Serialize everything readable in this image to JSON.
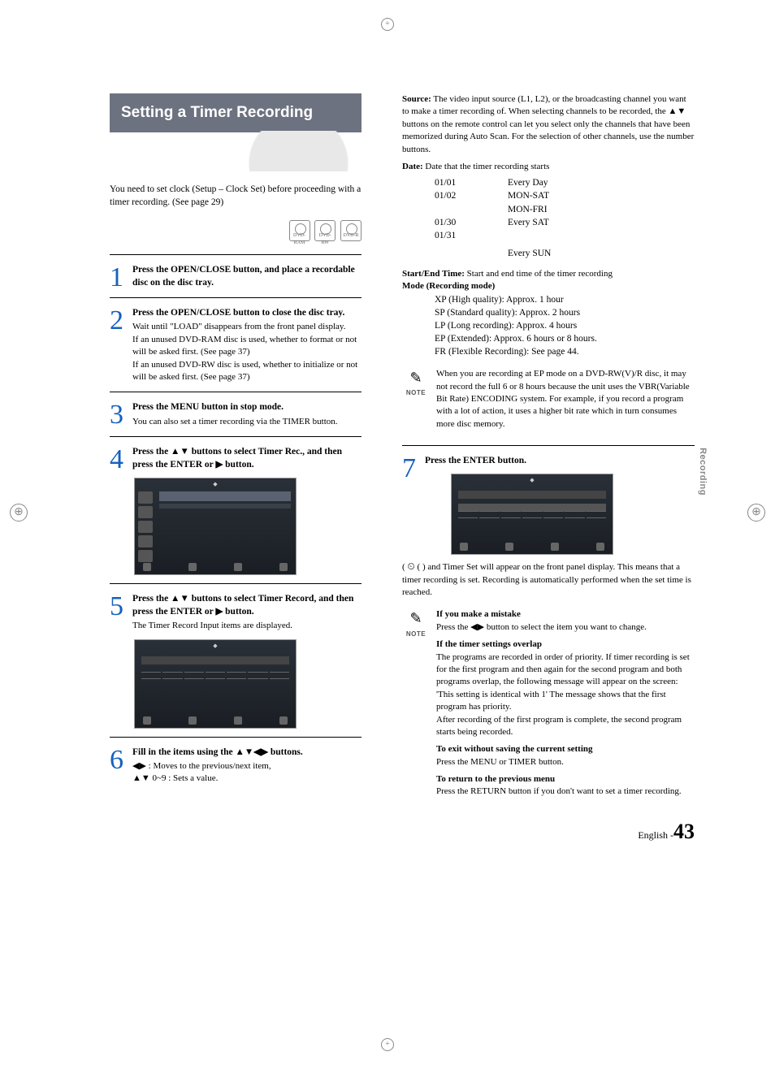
{
  "title": "Setting a Timer Recording",
  "intro": "You need to set clock (Setup – Clock Set) before proceeding with a timer recording. (See page 29)",
  "disc_icons": [
    "DVD-RAM",
    "DVD-RW",
    "DVD-R"
  ],
  "steps": {
    "s1": {
      "num": "1",
      "head": "Press the OPEN/CLOSE button, and place a recordable disc on the disc tray."
    },
    "s2": {
      "num": "2",
      "head": "Press the OPEN/CLOSE button to close the disc tray.",
      "body": "Wait until \"LOAD\" disappears from the front panel display.\nIf an unused DVD-RAM disc is used, whether to format or not will be asked first. (See page 37)\nIf an unused DVD-RW disc is used, whether to initialize or not will be asked first. (See page 37)"
    },
    "s3": {
      "num": "3",
      "head": "Press the MENU button in stop mode.",
      "body": "You can also set a timer recording via the TIMER button."
    },
    "s4": {
      "num": "4",
      "head": "Press the ▲▼ buttons to select Timer Rec., and then press the ENTER or ▶ button."
    },
    "s5": {
      "num": "5",
      "head": "Press the ▲▼ buttons to select Timer Record, and then press the ENTER or ▶ button.",
      "body": "The Timer Record Input items are displayed."
    },
    "s6": {
      "num": "6",
      "head": "Fill in the items using the ▲▼◀▶ buttons.",
      "body_a": "◀▶ : Moves to the previous/next item,",
      "body_b": "▲▼ 0~9 : Sets a value."
    },
    "s7": {
      "num": "7",
      "head": "Press the ENTER button."
    }
  },
  "right": {
    "source": {
      "label": "Source:",
      "text": "The video input source (L1, L2), or  the broadcasting channel you want to make a  timer recording of. When selecting channels to be recorded, the ▲▼ buttons on the remote control can let you select only the channels that have been memorized during Auto Scan. For the selection of other channels, use the number buttons."
    },
    "date": {
      "label": "Date:",
      "text": "Date that the timer recording starts",
      "rows": [
        {
          "a": "01/01",
          "b": "Every Day"
        },
        {
          "a": "01/02",
          "b": "MON-SAT"
        },
        {
          "a": "",
          "b": "MON-FRI"
        },
        {
          "a": "01/30",
          "b": "Every SAT"
        },
        {
          "a": "01/31",
          "b": ""
        },
        {
          "a": "",
          "b": "Every SUN"
        }
      ]
    },
    "time": {
      "label": "Start/End Time:",
      "text": "Start and end time of the timer recording"
    },
    "mode": {
      "label": "Mode (Recording mode)",
      "items": [
        "XP (High quality): Approx. 1 hour",
        "SP (Standard quality): Approx. 2 hours",
        "LP (Long recording): Approx. 4 hours",
        "EP (Extended): Approx. 6 hours or 8 hours.",
        "FR (Flexible Recording): See page 44."
      ]
    },
    "note1": "When you are recording at EP mode on a DVD-RW(V)/R disc, it may not record the full 6 or 8 hours because the unit uses the VBR(Variable Bit Rate) ENCODING system. For example, if you record a program with a lot of action, it uses a higher bit rate which in turn consumes more disc memory.",
    "after7": "(  ) and Timer Set will appear on the front panel display. This means that a timer recording is set. Recording is automatically performed when the set time is reached.",
    "note2": {
      "mistake_head": "If you make a mistake",
      "mistake_body": "Press the ◀▶ button to select the item you want to change.",
      "overlap_head": "If the timer settings overlap",
      "overlap_body": "The programs are recorded in order of priority. If timer recording is set for the first program and then again for the second program and both programs overlap, the following message will appear on the screen: 'This setting is identical with 1' The message shows that the first program has priority.\nAfter recording of the first program is complete, the second program starts being recorded.",
      "exit_head": "To exit without saving the current setting",
      "exit_body": "Press the MENU or TIMER button.",
      "return_head": "To return to the previous menu",
      "return_body": "Press the RETURN button if you don't want to set a timer recording."
    }
  },
  "side_label": "Recording",
  "footer": {
    "lang": "English -",
    "page": "43"
  },
  "note_label": "NOTE",
  "clock_glyph": "⏲"
}
